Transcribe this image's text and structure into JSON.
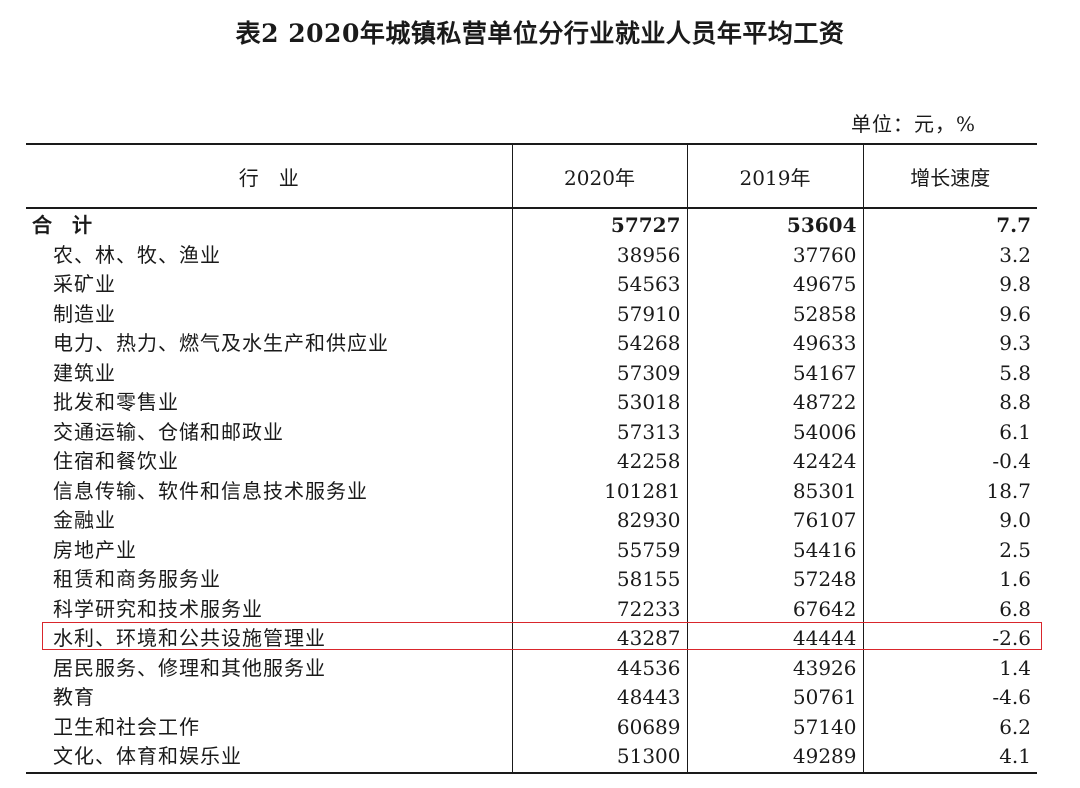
{
  "title": "表2  2020年城镇私营单位分行业就业人员年平均工资",
  "unit": "单位：元，%",
  "headers": {
    "industry": "行　业",
    "y2020": "2020年",
    "y2019": "2019年",
    "growth": "增长速度"
  },
  "total": {
    "name": "合　计",
    "y2020": "57727",
    "y2019": "53604",
    "growth": "7.7"
  },
  "rows": [
    {
      "name": "农、林、牧、渔业",
      "y2020": "38956",
      "y2019": "37760",
      "growth": "3.2"
    },
    {
      "name": "采矿业",
      "y2020": "54563",
      "y2019": "49675",
      "growth": "9.8"
    },
    {
      "name": "制造业",
      "y2020": "57910",
      "y2019": "52858",
      "growth": "9.6"
    },
    {
      "name": "电力、热力、燃气及水生产和供应业",
      "y2020": "54268",
      "y2019": "49633",
      "growth": "9.3"
    },
    {
      "name": "建筑业",
      "y2020": "57309",
      "y2019": "54167",
      "growth": "5.8"
    },
    {
      "name": "批发和零售业",
      "y2020": "53018",
      "y2019": "48722",
      "growth": "8.8"
    },
    {
      "name": "交通运输、仓储和邮政业",
      "y2020": "57313",
      "y2019": "54006",
      "growth": "6.1"
    },
    {
      "name": "住宿和餐饮业",
      "y2020": "42258",
      "y2019": "42424",
      "growth": "-0.4"
    },
    {
      "name": "信息传输、软件和信息技术服务业",
      "y2020": "101281",
      "y2019": "85301",
      "growth": "18.7"
    },
    {
      "name": "金融业",
      "y2020": "82930",
      "y2019": "76107",
      "growth": "9.0"
    },
    {
      "name": "房地产业",
      "y2020": "55759",
      "y2019": "54416",
      "growth": "2.5"
    },
    {
      "name": "租赁和商务服务业",
      "y2020": "58155",
      "y2019": "57248",
      "growth": "1.6"
    },
    {
      "name": "科学研究和技术服务业",
      "y2020": "72233",
      "y2019": "67642",
      "growth": "6.8"
    },
    {
      "name": "水利、环境和公共设施管理业",
      "y2020": "43287",
      "y2019": "44444",
      "growth": "-2.6"
    },
    {
      "name": "居民服务、修理和其他服务业",
      "y2020": "44536",
      "y2019": "43926",
      "growth": "1.4"
    },
    {
      "name": "教育",
      "y2020": "48443",
      "y2019": "50761",
      "growth": "-4.6"
    },
    {
      "name": "卫生和社会工作",
      "y2020": "60689",
      "y2019": "57140",
      "growth": "6.2"
    },
    {
      "name": "文化、体育和娱乐业",
      "y2020": "51300",
      "y2019": "49289",
      "growth": "4.1"
    }
  ],
  "highlight_color": "#d9262c"
}
